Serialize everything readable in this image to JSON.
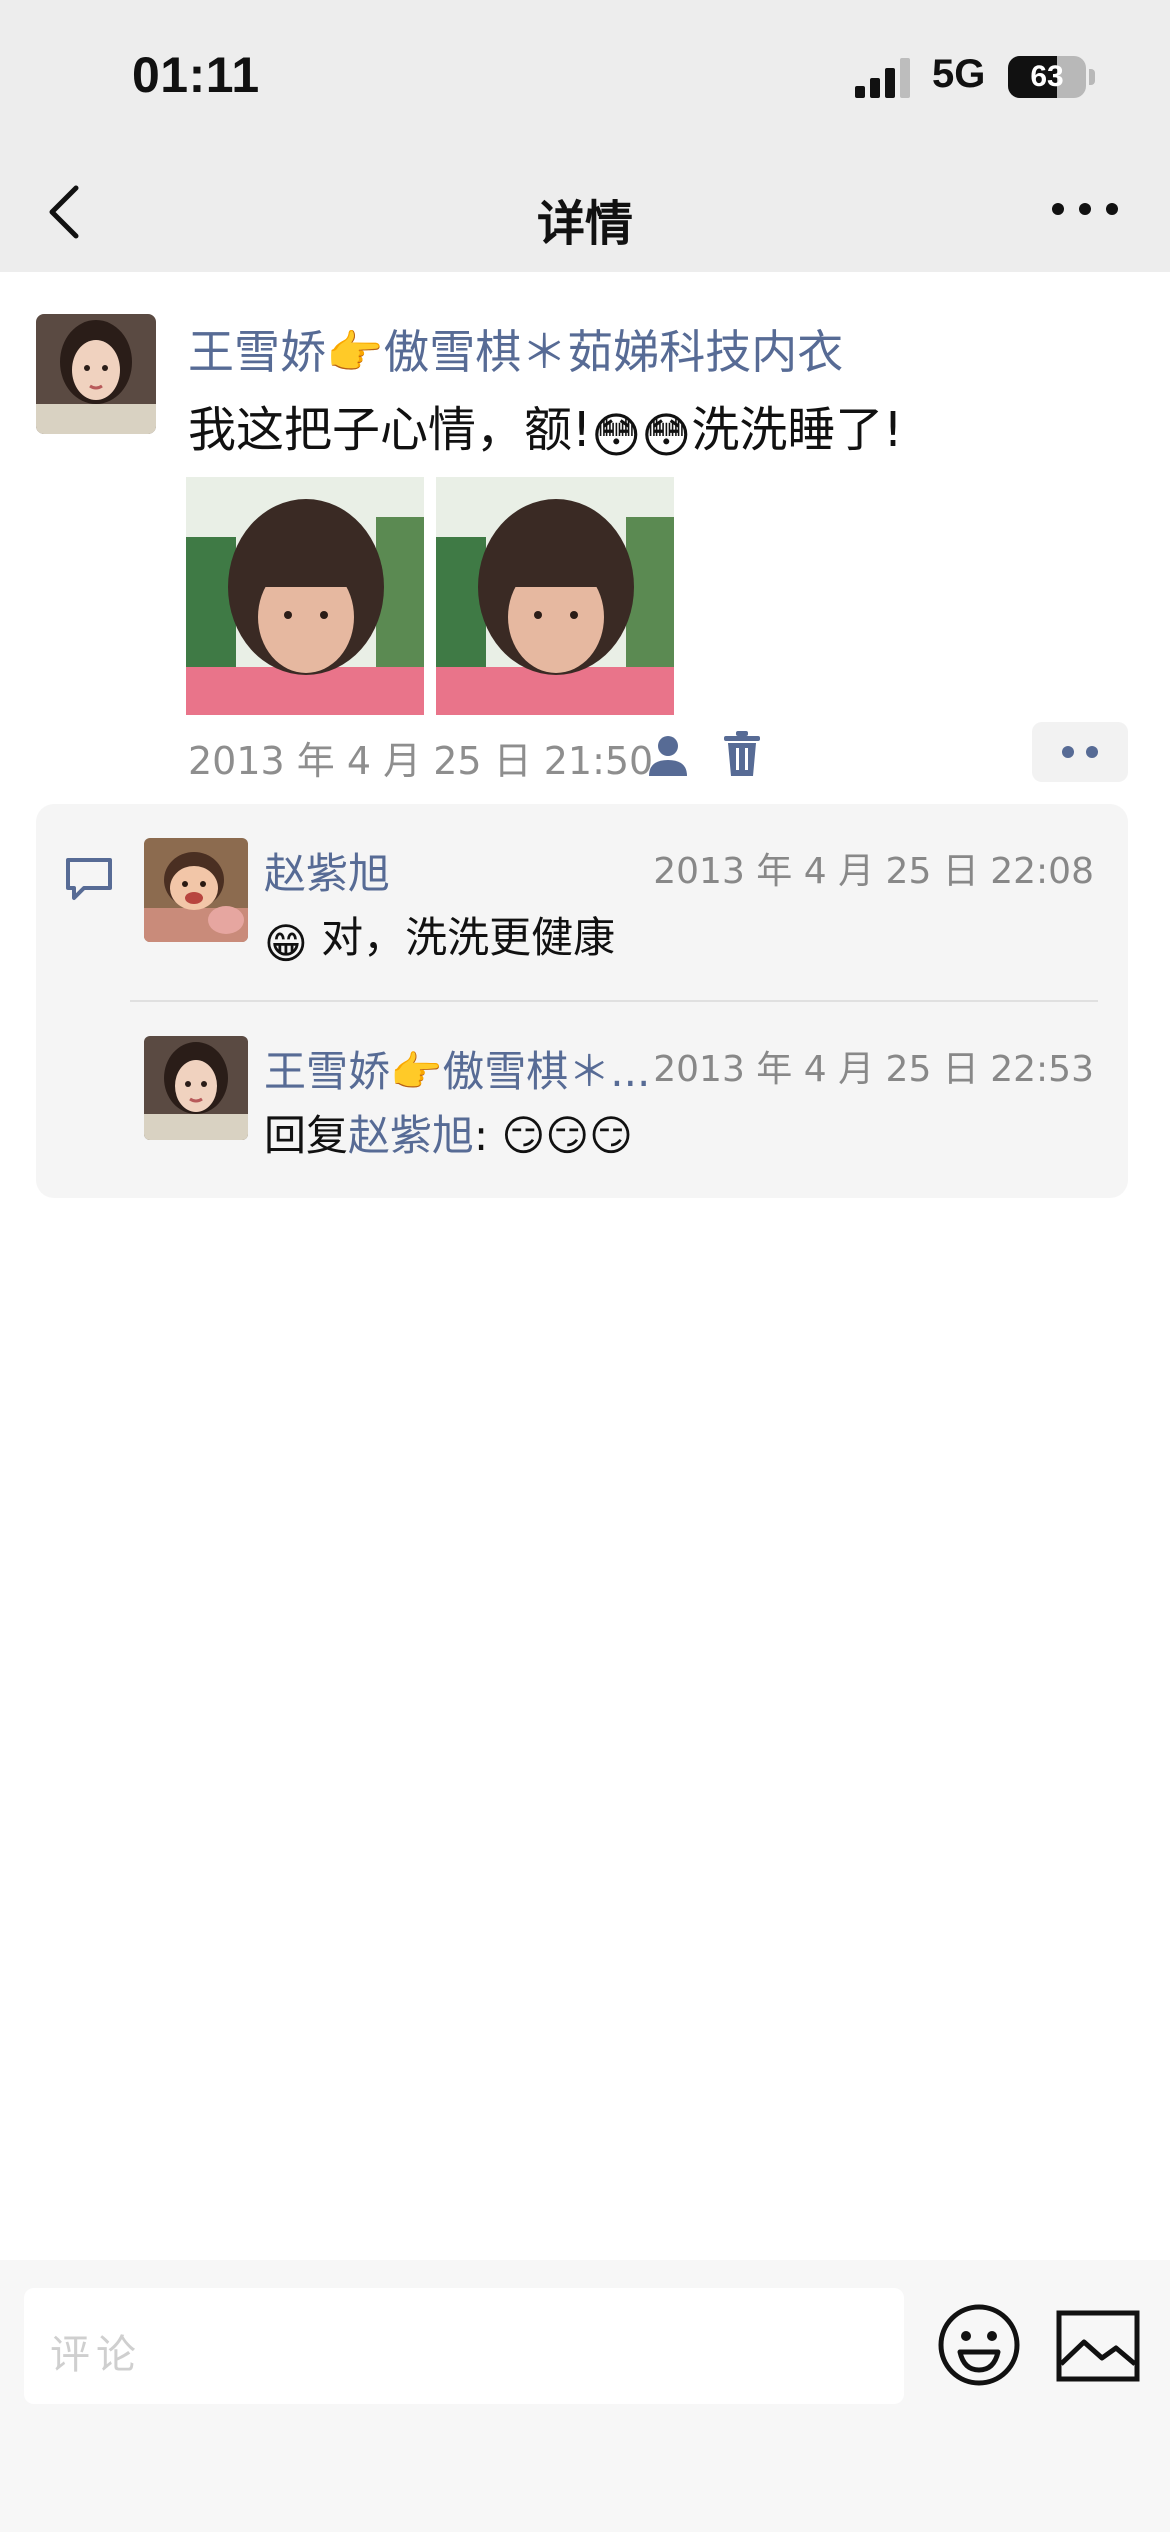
{
  "status": {
    "time": "01:11",
    "network": "5G",
    "battery": "63",
    "battery_level": 0.63
  },
  "nav": {
    "title": "详情"
  },
  "post": {
    "author": "王雪娇👉傲雪棋＊茹娣科技内衣",
    "text_before": "我这把子心情，额!",
    "text_emojis": "😳😳",
    "text_after": "洗洗睡了!",
    "time": "2013 年 4 月 25 日  21:50",
    "icons": [
      "friend-icon",
      "delete-icon",
      "more-dots-icon"
    ]
  },
  "comments": [
    {
      "name": "赵紫旭",
      "time": "2013 年 4 月 25 日 22:08",
      "emoji": "😁",
      "text": " 对，洗洗更健康"
    },
    {
      "name": "王雪娇👉傲雪棋＊...",
      "time": "2013 年 4 月 25 日 22:53",
      "reply_prefix": "回复",
      "reply_to": "赵紫旭",
      "text": ": 😏😏😏"
    }
  ],
  "input": {
    "placeholder": "评论"
  },
  "colors": {
    "link": "#576b95",
    "header_bg": "#ededed",
    "comment_bg": "#f5f5f5"
  }
}
